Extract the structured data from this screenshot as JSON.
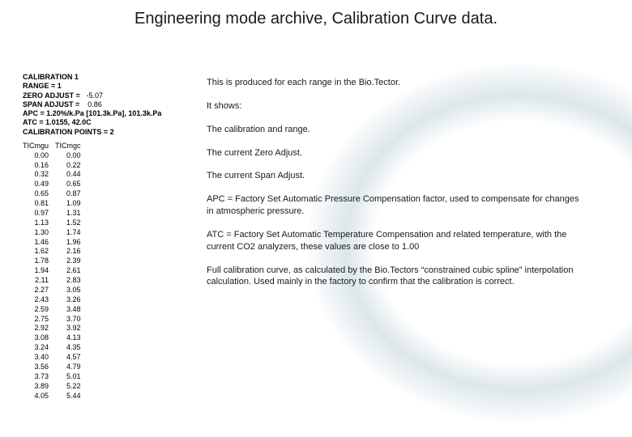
{
  "title": "Engineering mode archive, Calibration Curve data.",
  "panel": {
    "calibration_label": "CALIBRATION 1",
    "range_label": "RANGE = 1",
    "zero_label": "ZERO ADJUST =",
    "zero_value": "-5.07",
    "span_label": "SPAN ADJUST =",
    "span_value": "0.86",
    "apc_line": "APC = 1.20%/k.Pa [101.3k.Pa], 101.3k.Pa",
    "atc_line": "ATC = 1.0155, 42.0C",
    "cal_points_label": "CALIBRATION POINTS = 2",
    "col1": "TICmgu",
    "col2": "TICmgc",
    "rows": [
      [
        "0.00",
        "0.00"
      ],
      [
        "0.16",
        "0.22"
      ],
      [
        "0.32",
        "0.44"
      ],
      [
        "0.49",
        "0.65"
      ],
      [
        "0.65",
        "0.87"
      ],
      [
        "0.81",
        "1.09"
      ],
      [
        "0.97",
        "1.31"
      ],
      [
        "1.13",
        "1.52"
      ],
      [
        "1.30",
        "1.74"
      ],
      [
        "1.46",
        "1.96"
      ],
      [
        "1.62",
        "2.16"
      ],
      [
        "1.78",
        "2.39"
      ],
      [
        "1.94",
        "2.61"
      ],
      [
        "2.11",
        "2.83"
      ],
      [
        "2.27",
        "3.05"
      ],
      [
        "2.43",
        "3.26"
      ],
      [
        "2.59",
        "3.48"
      ],
      [
        "2.75",
        "3.70"
      ],
      [
        "2.92",
        "3.92"
      ],
      [
        "3.08",
        "4.13"
      ],
      [
        "3.24",
        "4.35"
      ],
      [
        "3.40",
        "4.57"
      ],
      [
        "3.56",
        "4.79"
      ],
      [
        "3.73",
        "5.01"
      ],
      [
        "3.89",
        "5.22"
      ],
      [
        "4.05",
        "5.44"
      ]
    ]
  },
  "desc": {
    "p1": "This is produced for each range in the Bio.Tector.",
    "p2": "It shows:",
    "p3": "The calibration and range.",
    "p4": "The current Zero Adjust.",
    "p5": "The current Span Adjust.",
    "p6": "APC = Factory Set Automatic Pressure Compensation factor, used to compensate for changes in atmospheric pressure.",
    "p7": "ATC = Factory Set Automatic Temperature Compensation and related temperature, with the current CO2 analyzers, these values are close to 1.00",
    "p8": "Full calibration curve, as calculated by the Bio.Tectors “constrained cubic spline” interpolation calculation. Used mainly in the factory to confirm that the calibration is correct."
  },
  "chart_data": {
    "type": "table",
    "title": "Calibration Curve data",
    "columns": [
      "TICmgu",
      "TICmgc"
    ],
    "rows": [
      [
        0.0,
        0.0
      ],
      [
        0.16,
        0.22
      ],
      [
        0.32,
        0.44
      ],
      [
        0.49,
        0.65
      ],
      [
        0.65,
        0.87
      ],
      [
        0.81,
        1.09
      ],
      [
        0.97,
        1.31
      ],
      [
        1.13,
        1.52
      ],
      [
        1.3,
        1.74
      ],
      [
        1.46,
        1.96
      ],
      [
        1.62,
        2.16
      ],
      [
        1.78,
        2.39
      ],
      [
        1.94,
        2.61
      ],
      [
        2.11,
        2.83
      ],
      [
        2.27,
        3.05
      ],
      [
        2.43,
        3.26
      ],
      [
        2.59,
        3.48
      ],
      [
        2.75,
        3.7
      ],
      [
        2.92,
        3.92
      ],
      [
        3.08,
        4.13
      ],
      [
        3.24,
        4.35
      ],
      [
        3.4,
        4.57
      ],
      [
        3.56,
        4.79
      ],
      [
        3.73,
        5.01
      ],
      [
        3.89,
        5.22
      ],
      [
        4.05,
        5.44
      ]
    ]
  }
}
